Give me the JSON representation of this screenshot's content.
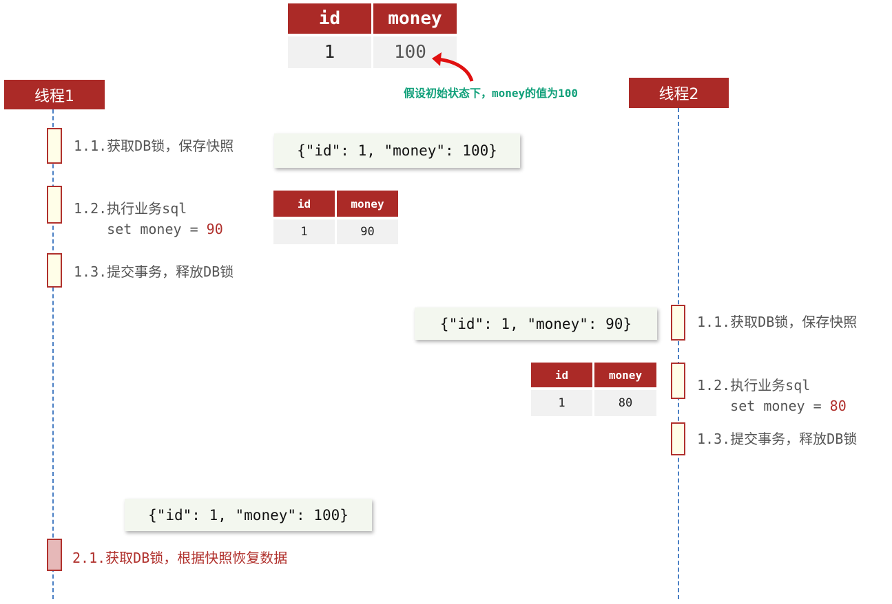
{
  "main_table": {
    "headers": [
      "id",
      "money"
    ],
    "row": [
      "1",
      "100"
    ]
  },
  "annotation": "假设初始状态下，money的值为100",
  "threads": [
    {
      "label": "线程1"
    },
    {
      "label": "线程2"
    }
  ],
  "thread1": {
    "step1": "1.1.获取DB锁，保存快照",
    "snapshot1": "{\"id\": 1, \"money\": 100}",
    "step2_line1": "1.2.执行业务sql",
    "step2_line2": "set money = ",
    "step2_value": "90",
    "table": {
      "headers": [
        "id",
        "money"
      ],
      "row": [
        "1",
        "90"
      ]
    },
    "step3": "1.3.提交事务，释放DB锁",
    "snapshot2": "{\"id\": 1, \"money\": 100}",
    "step4": "2.1.获取DB锁，根据快照恢复数据"
  },
  "thread2": {
    "step1": "1.1.获取DB锁，保存快照",
    "snapshot1": "{\"id\": 1, \"money\": 90}",
    "step2_line1": "1.2.执行业务sql",
    "step2_line2": "set money = ",
    "step2_value": "80",
    "table": {
      "headers": [
        "id",
        "money"
      ],
      "row": [
        "1",
        "80"
      ]
    },
    "step3": "1.3.提交事务，释放DB锁"
  },
  "colors": {
    "header": "#ab2a27",
    "annotation": "#11a07a",
    "lifeline": "#4a7fc4",
    "activation": "#fffee8",
    "rollback_activation": "#e6b8b8"
  }
}
